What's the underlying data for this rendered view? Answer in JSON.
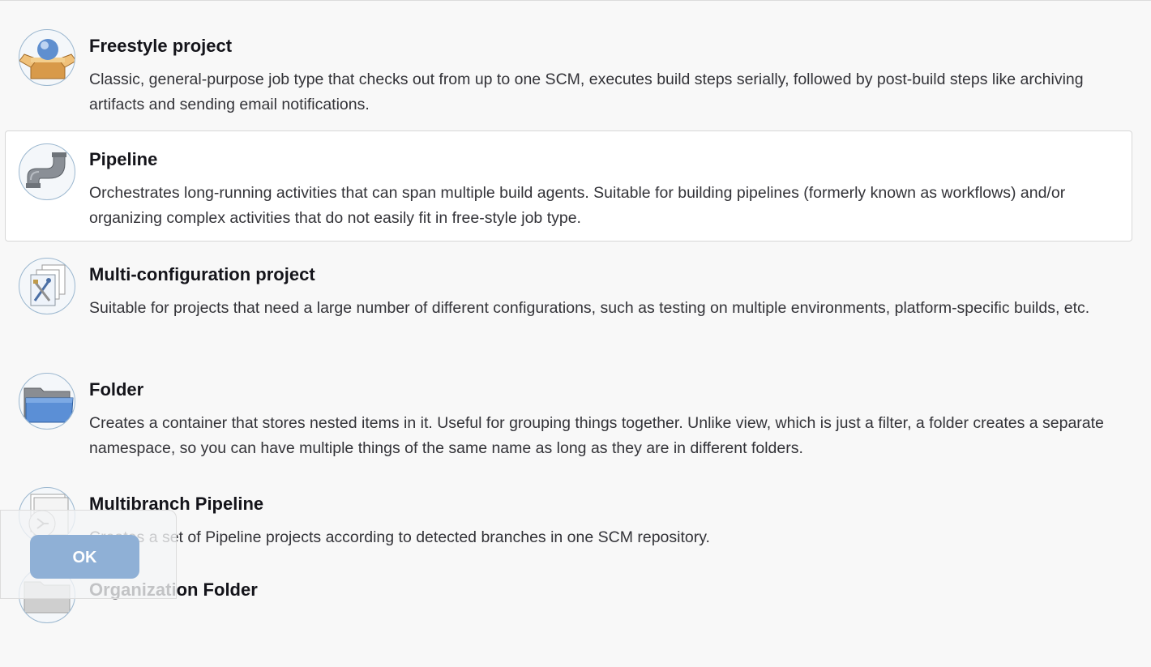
{
  "items": [
    {
      "title": "Freestyle project",
      "description": "Classic, general-purpose job type that checks out from up to one SCM, executes build steps serially, followed by post-build steps like archiving artifacts and sending email notifications.",
      "icon": "freestyle-box-icon"
    },
    {
      "title": "Pipeline",
      "description": "Orchestrates long-running activities that can span multiple build agents. Suitable for building pipelines (formerly known as workflows) and/or organizing complex activities that do not easily fit in free-style job type.",
      "icon": "pipe-icon"
    },
    {
      "title": "Multi-configuration project",
      "description": "Suitable for projects that need a large number of different configurations, such as testing on multiple environments, platform-specific builds, etc.",
      "icon": "multi-config-icon"
    },
    {
      "title": "Folder",
      "description": "Creates a container that stores nested items in it. Useful for grouping things together. Unlike view, which is just a filter, a folder creates a separate namespace, so you can have multiple things of the same name as long as they are in different folders.",
      "icon": "folder-icon"
    },
    {
      "title": "Multibranch Pipeline",
      "description": "Creates a set of Pipeline projects according to detected branches in one SCM repository.",
      "icon": "multibranch-icon"
    },
    {
      "title": "Organization Folder",
      "description": "",
      "icon": "organization-folder-icon"
    }
  ],
  "footer": {
    "ok_label": "OK"
  },
  "colors": {
    "ok_button": "#8fb0d6",
    "selected_item_bg": "#ffffff",
    "page_bg": "#f8f8f8"
  }
}
